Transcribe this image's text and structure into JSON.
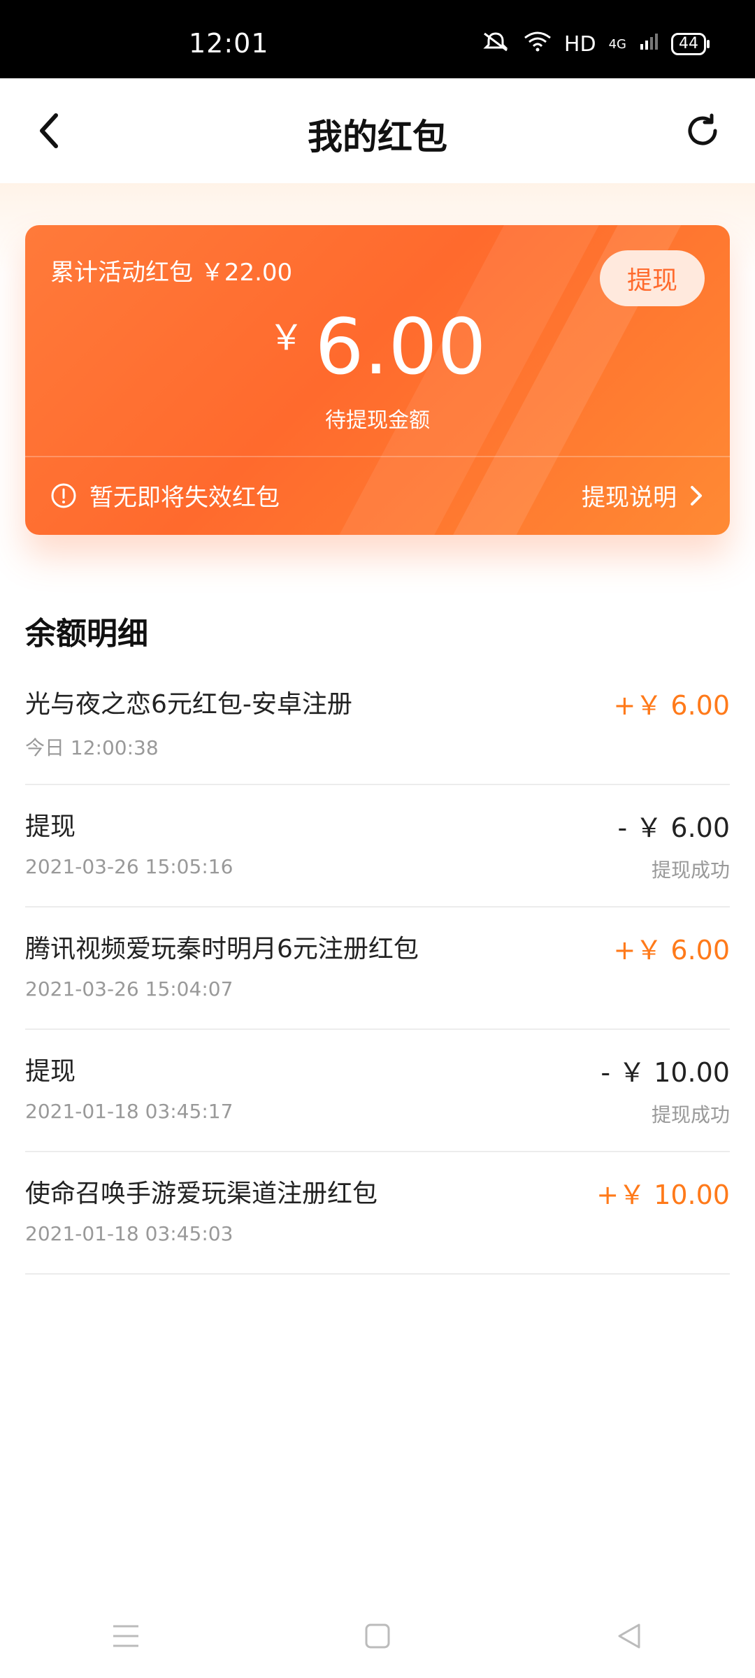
{
  "status": {
    "time": "12:01",
    "network": "HD",
    "signal": "4G",
    "battery": "44"
  },
  "header": {
    "title": "我的红包",
    "back_icon": "chevron-left-icon",
    "refresh_icon": "refresh-icon"
  },
  "card": {
    "total_label": "累计活动红包 ￥22.00",
    "withdraw_button": "提现",
    "currency": "￥",
    "pending_amount": "6.00",
    "pending_label": "待提现金额",
    "notice": "暂无即将失效红包",
    "explain_link": "提现说明",
    "colors": {
      "card_start": "#ff7a3a",
      "card_end": "#ff8a34",
      "button_bg": "#ffe9dd",
      "accent": "#ff6a2d"
    }
  },
  "balance": {
    "title": "余额明细",
    "items": [
      {
        "title": "光与夜之恋6元红包-安卓注册",
        "time": "今日 12:00:38",
        "amount": "+￥ 6.00",
        "status": ""
      },
      {
        "title": "提现",
        "time": "2021-03-26 15:05:16",
        "amount": "- ￥ 6.00",
        "status": "提现成功"
      },
      {
        "title": "腾讯视频爱玩秦时明月6元注册红包",
        "time": "2021-03-26 15:04:07",
        "amount": "+￥ 6.00",
        "status": ""
      },
      {
        "title": "提现",
        "time": "2021-01-18 03:45:17",
        "amount": "- ￥ 10.00",
        "status": "提现成功"
      },
      {
        "title": "使命召唤手游爱玩渠道注册红包",
        "time": "2021-01-18 03:45:03",
        "amount": "+￥ 10.00",
        "status": ""
      }
    ]
  },
  "nav": {
    "menu_icon": "menu-icon",
    "home_icon": "home-square-icon",
    "back_icon": "back-triangle-icon"
  }
}
